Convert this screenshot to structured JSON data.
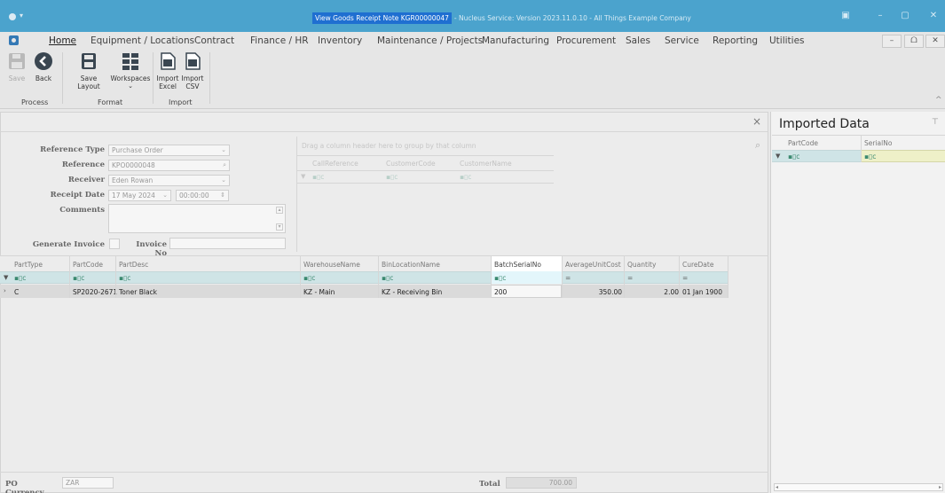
{
  "window": {
    "title_main": "View Goods Receipt Note KGR00000047",
    "title_sub": "- Nucleus Service: Version 2023.11.0.10 - All Things Example Company",
    "controls": [
      "▣",
      "–",
      "▢",
      "✕"
    ]
  },
  "menu": {
    "items": [
      "Home",
      "Equipment / Locations",
      "Contract",
      "Finance / HR",
      "Inventory",
      "Maintenance / Projects",
      "Manufacturing",
      "Procurement",
      "Sales",
      "Service",
      "Reporting",
      "Utilities"
    ],
    "window_buttons": [
      "–",
      "ᗝ",
      "✕"
    ]
  },
  "ribbon": {
    "save": "Save",
    "back": "Back",
    "save_layout": "Save Layout",
    "workspaces": "Workspaces",
    "import_excel": "Import Excel",
    "import_csv": "Import CSV",
    "group_process": "Process",
    "group_format": "Format",
    "group_import": "Import"
  },
  "form": {
    "reference_type_label": "Reference Type",
    "reference_type": "Purchase Order",
    "reference_label": "Reference",
    "reference": "KPO0000048",
    "receiver_label": "Receiver",
    "receiver": "Eden Rowan",
    "receipt_date_label": "Receipt Date",
    "receipt_date": "17 May 2024",
    "receipt_time": "00:00:00",
    "comments_label": "Comments",
    "comments": "",
    "generate_invoice_label": "Generate Invoice",
    "invoice_no_label": "Invoice No",
    "invoice_no": ""
  },
  "top_grid": {
    "group_hint": "Drag a column header here to group by that column",
    "headers": [
      "CallReference",
      "CustomerCode",
      "CustomerName"
    ]
  },
  "grid": {
    "headers": [
      "PartType",
      "PartCode",
      "PartDesc",
      "WarehouseName",
      "BinLocationName",
      "BatchSerialNo",
      "AverageUnitCost",
      "Quantity",
      "CureDate"
    ],
    "filter_glyph": "▪▯c",
    "eq_glyph": "=",
    "row": {
      "PartType": "C",
      "PartCode": "SP2020-2671",
      "PartDesc": "Toner Black",
      "WarehouseName": "KZ - Main",
      "BinLocationName": "KZ - Receiving Bin",
      "BatchSerialNo": "200",
      "AverageUnitCost": "350.00",
      "Quantity": "2.00",
      "CureDate": "01 Jan 1900"
    }
  },
  "footer": {
    "po_currency_label": "PO Currency",
    "po_currency": "ZAR",
    "total_label": "Total",
    "total": "700.00"
  },
  "side": {
    "title": "Imported Data",
    "headers": [
      "PartCode",
      "SerialNo"
    ]
  }
}
